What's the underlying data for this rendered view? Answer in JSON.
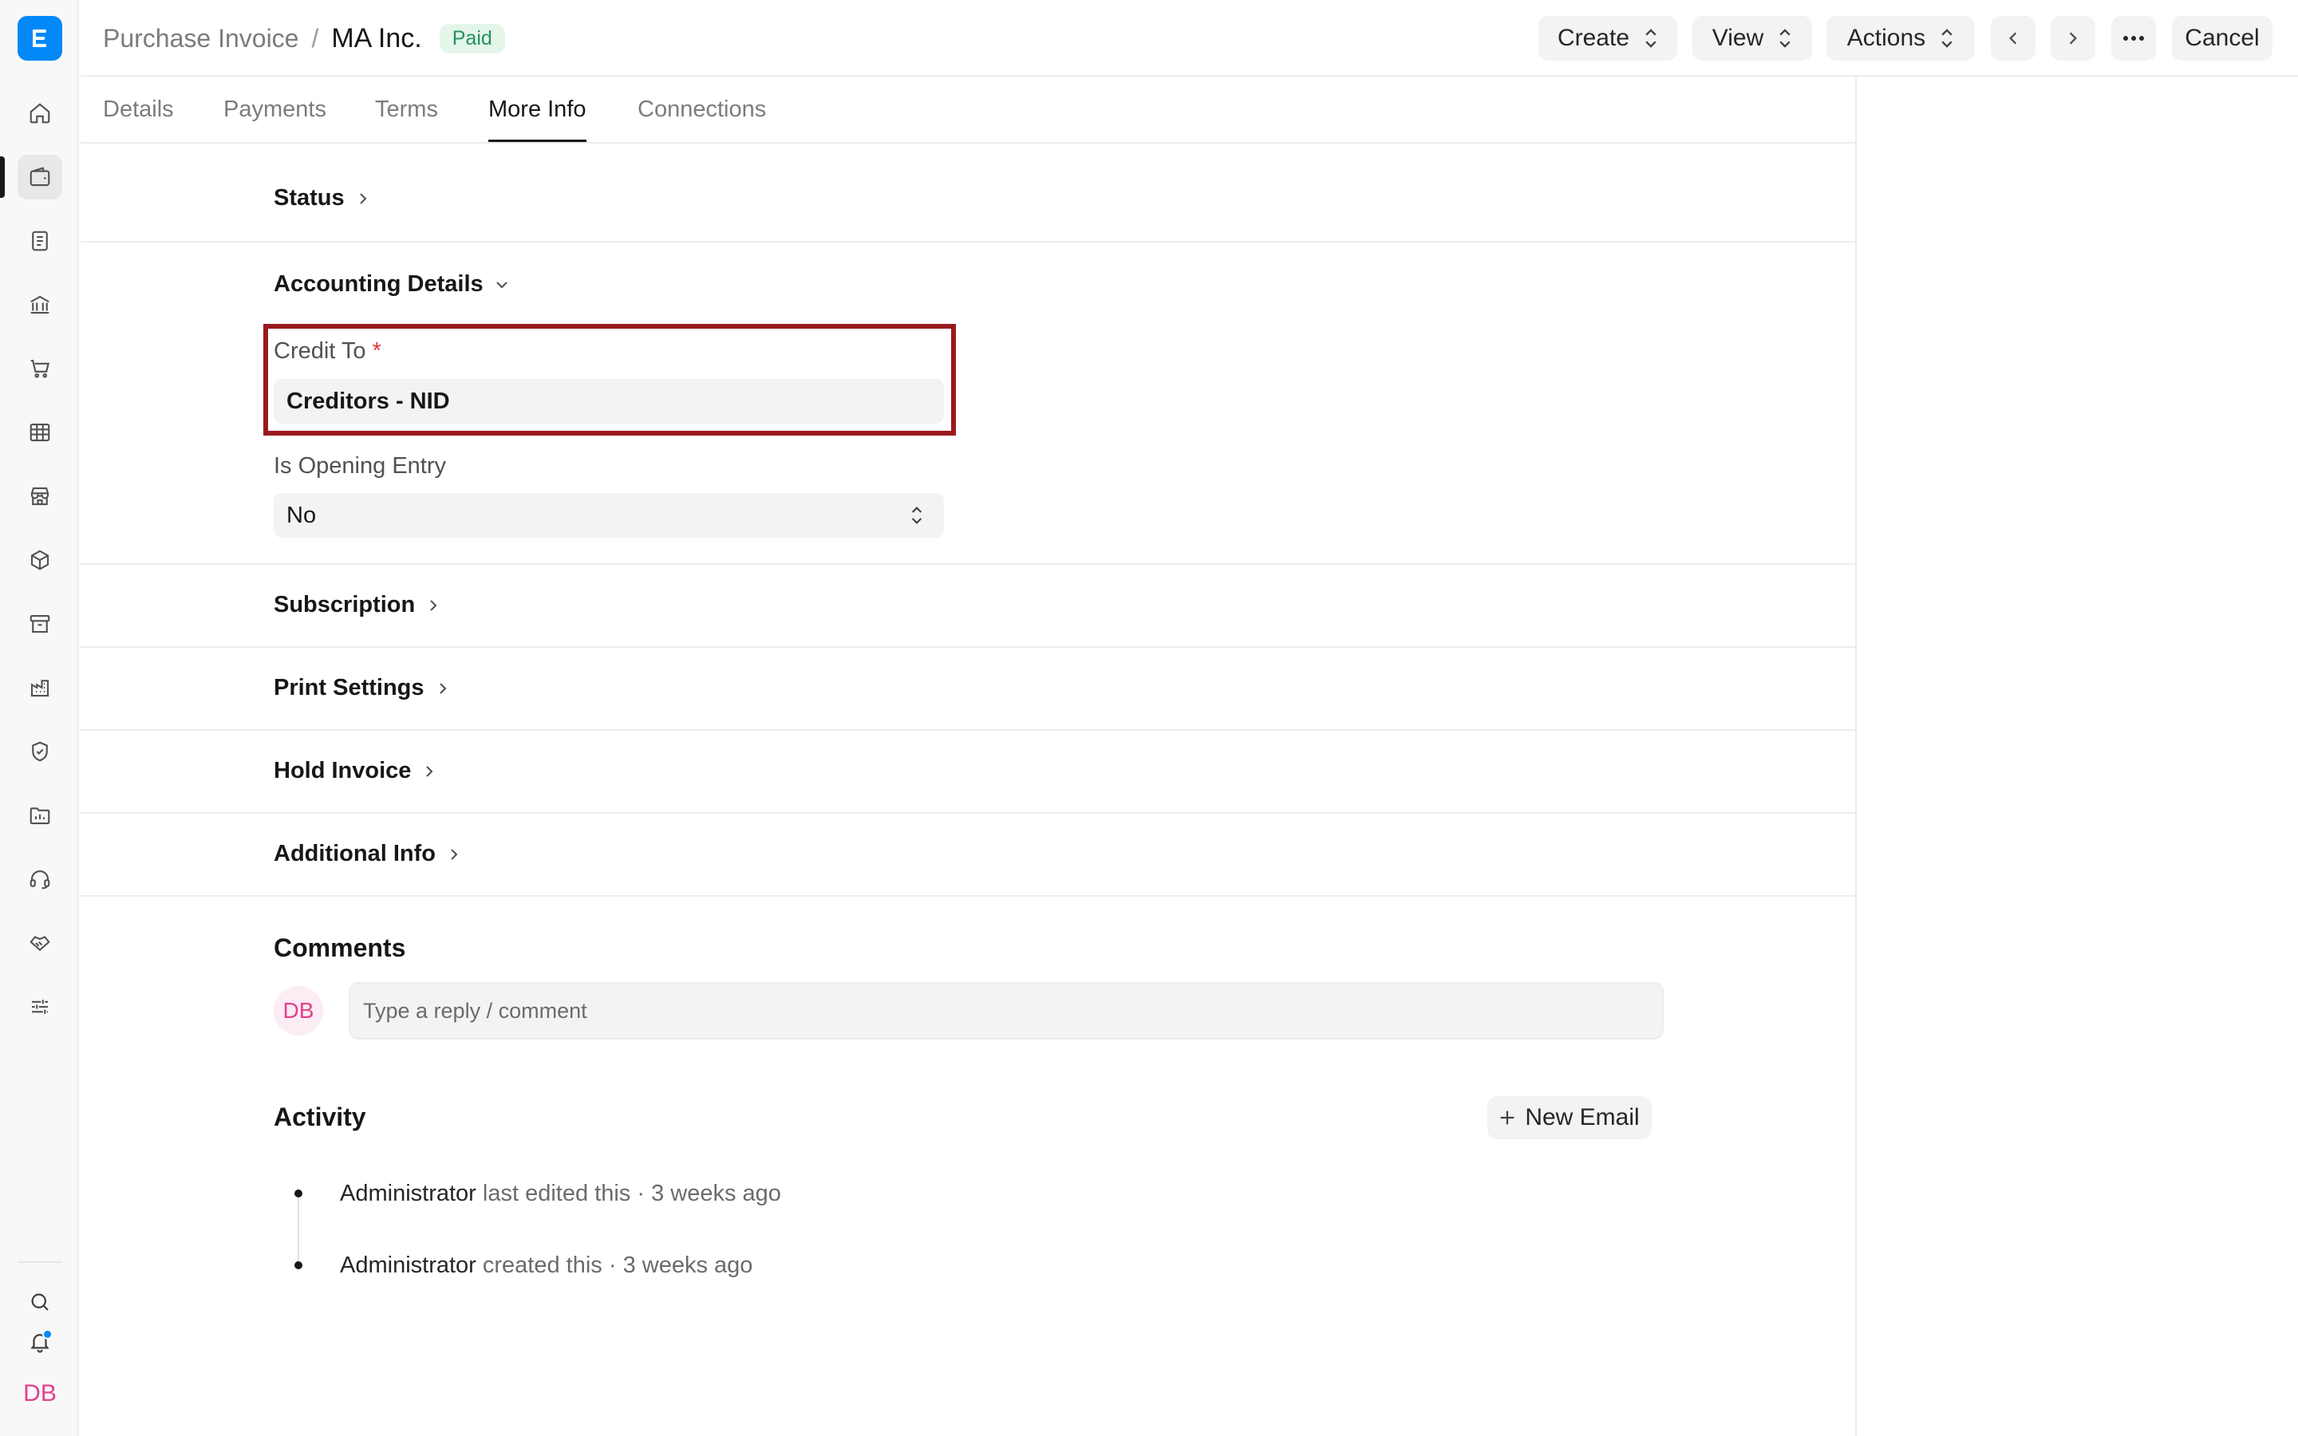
{
  "sidebar": {
    "logo_letter": "E",
    "user_initials": "DB",
    "items": [
      {
        "icon": "home-icon"
      },
      {
        "icon": "wallet-icon",
        "active": true
      },
      {
        "icon": "file-text-icon"
      },
      {
        "icon": "bank-icon"
      },
      {
        "icon": "shopping-cart-icon"
      },
      {
        "icon": "table-icon"
      },
      {
        "icon": "store-icon"
      },
      {
        "icon": "package-icon"
      },
      {
        "icon": "archive-icon"
      },
      {
        "icon": "building-icon"
      },
      {
        "icon": "shield-check-icon"
      },
      {
        "icon": "folder-chart-icon"
      },
      {
        "icon": "headset-icon"
      },
      {
        "icon": "handshake-icon"
      },
      {
        "icon": "sliders-icon"
      }
    ],
    "bottom": [
      {
        "icon": "search-icon"
      },
      {
        "icon": "bell-icon"
      }
    ]
  },
  "header": {
    "breadcrumb_parent": "Purchase Invoice",
    "separator": "/",
    "title": "MA Inc.",
    "status": "Paid",
    "buttons": {
      "create": "Create",
      "view": "View",
      "actions": "Actions",
      "cancel": "Cancel"
    }
  },
  "tabs": [
    "Details",
    "Payments",
    "Terms",
    "More Info",
    "Connections"
  ],
  "active_tab": "More Info",
  "sections": {
    "status": "Status",
    "accounting": "Accounting Details",
    "subscription": "Subscription",
    "print_settings": "Print Settings",
    "hold_invoice": "Hold Invoice",
    "additional_info": "Additional Info"
  },
  "fields": {
    "credit_to": {
      "label": "Credit To",
      "required_mark": "*",
      "value": "Creditors - NID"
    },
    "is_opening_entry": {
      "label": "Is Opening Entry",
      "value": "No"
    }
  },
  "comments": {
    "title": "Comments",
    "avatar_initials": "DB",
    "placeholder": "Type a reply / comment"
  },
  "activity": {
    "title": "Activity",
    "new_email_label": "New Email",
    "items": [
      {
        "user": "Administrator",
        "action": "last edited this",
        "time": "3 weeks ago"
      },
      {
        "user": "Administrator",
        "action": "created this",
        "time": "3 weeks ago"
      }
    ]
  },
  "colors": {
    "accent": "#0289f7",
    "paid_bg": "#e4f5e9",
    "paid_text": "#278f5e",
    "highlight": "#9a1a1e",
    "avatar": "#e2408c"
  }
}
